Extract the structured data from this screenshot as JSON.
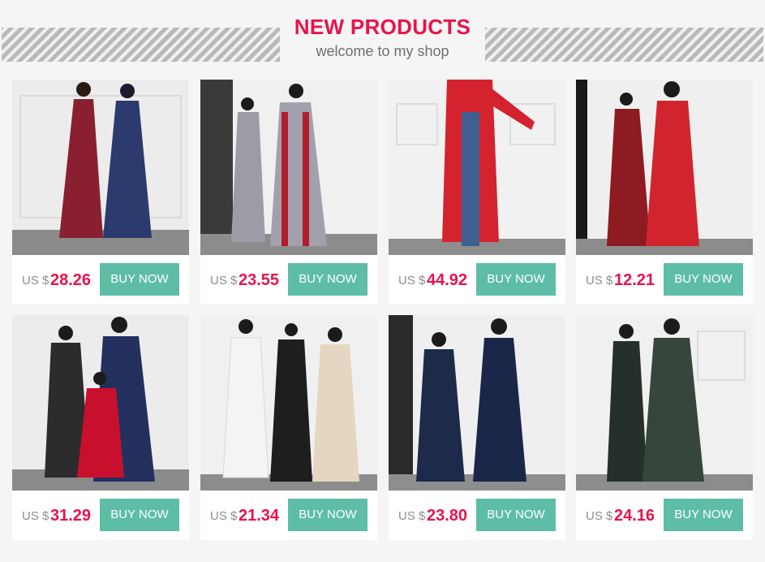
{
  "header": {
    "title": "NEW PRODUCTS",
    "subtitle": "welcome to my shop"
  },
  "colors": {
    "accent": "#e8134b",
    "button": "#5ebda6",
    "currency": "#8e8e8e"
  },
  "products": [
    {
      "currency": "US $",
      "price": "28.26",
      "button": "BUY NOW",
      "photo_icon": "product-photo-two-women-red-navy-lace-abaya"
    },
    {
      "currency": "US $",
      "price": "23.55",
      "button": "BUY NOW",
      "photo_icon": "product-photo-grey-abaya-red-trim"
    },
    {
      "currency": "US $",
      "price": "44.92",
      "button": "BUY NOW",
      "photo_icon": "product-photo-red-kimono-jeans"
    },
    {
      "currency": "US $",
      "price": "12.21",
      "button": "BUY NOW",
      "photo_icon": "product-photo-red-ruffle-dress"
    },
    {
      "currency": "US $",
      "price": "31.29",
      "button": "BUY NOW",
      "photo_icon": "product-photo-three-women-embroidered-abaya"
    },
    {
      "currency": "US $",
      "price": "21.34",
      "button": "BUY NOW",
      "photo_icon": "product-photo-white-black-beige-sequin-abaya"
    },
    {
      "currency": "US $",
      "price": "23.80",
      "button": "BUY NOW",
      "photo_icon": "product-photo-floral-print-dress"
    },
    {
      "currency": "US $",
      "price": "24.16",
      "button": "BUY NOW",
      "photo_icon": "product-photo-green-abaya"
    }
  ]
}
